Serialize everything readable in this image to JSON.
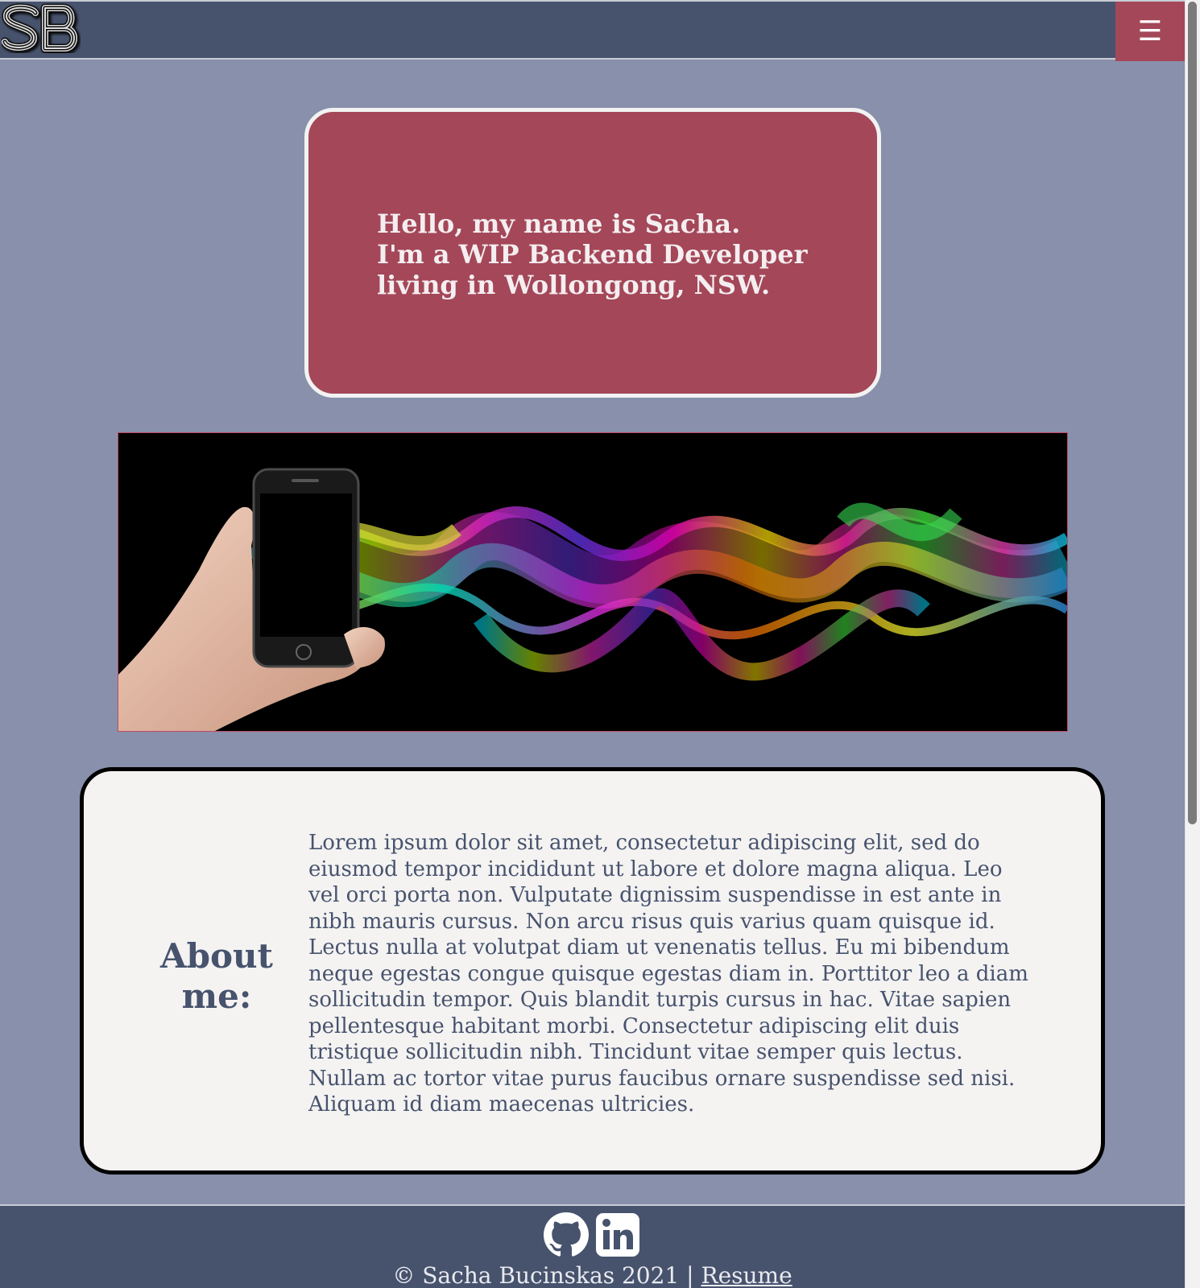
{
  "header": {
    "logo_text": "SB",
    "menu_icon": "hamburger-menu-icon",
    "menu_glyph": "☰"
  },
  "hero": {
    "lines": [
      "Hello, my name is Sacha.",
      "I'm a WIP Backend Developer",
      "living in Wollongong, NSW."
    ]
  },
  "banner": {
    "description_icon": "phone-hand-banner-image"
  },
  "about": {
    "title_line1": "About",
    "title_line2": "me:",
    "body_lines": [
      "Lorem ipsum dolor sit amet, consectetur adipiscing elit, sed do",
      "eiusmod tempor incididunt ut labore et dolore magna aliqua. Leo",
      "vel orci porta non. Vulputate dignissim suspendisse in est ante in",
      "nibh mauris cursus. Non arcu risus quis varius quam quisque id.",
      "Lectus nulla at volutpat diam ut venenatis tellus. Eu mi bibendum",
      "neque egestas congue quisque egestas diam in. Porttitor leo a diam",
      "sollicitudin tempor. Quis blandit turpis cursus in hac. Vitae sapien",
      "pellentesque habitant morbi. Consectetur adipiscing elit duis",
      "tristique sollicitudin nibh. Tincidunt vitae semper quis lectus.",
      "Nullam ac tortor vitae purus faucibus ornare suspendisse sed nisi.",
      "Aliquam id diam maecenas ultricies."
    ]
  },
  "footer": {
    "github_icon": "github-icon",
    "linkedin_icon": "linkedin-icon",
    "linkedin_text": "in",
    "copyright": "© Sacha Bucinskas 2021 |",
    "resume_link": "Resume"
  },
  "colors": {
    "page_bg": "#8890ab",
    "navy": "#47536d",
    "accent": "#a44759",
    "card_bg": "#f4f3f2"
  }
}
